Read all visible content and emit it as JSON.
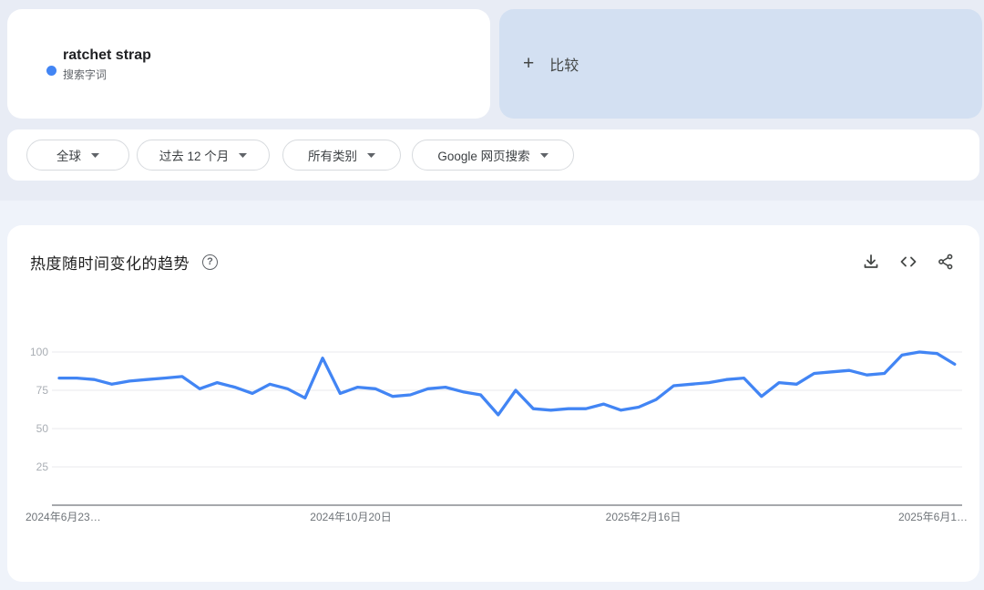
{
  "colors": {
    "accent": "#4285f4",
    "compare_card_bg": "#d3e0f2",
    "header_bg": "#e8ecf5",
    "results_bg": "#eff3fa",
    "grid_line": "#e8eaed",
    "axis_line": "#70757a",
    "y_tick_text": "#a9aeb4",
    "x_tick_text": "#70757a"
  },
  "term_card": {
    "term": "ratchet strap",
    "type_label": "搜索字词"
  },
  "compare_card": {
    "plus_symbol": "+",
    "label": "比较"
  },
  "filter_bar": {
    "filters": [
      {
        "label": "全球"
      },
      {
        "label": "过去 12 个月"
      },
      {
        "label": "所有类别"
      },
      {
        "label": "Google 网页搜索"
      }
    ]
  },
  "chart_section": {
    "title": "热度随时间变化的趋势",
    "help_glyph": "?",
    "actions": [
      {
        "icon": "download-icon"
      },
      {
        "icon": "embed-icon"
      },
      {
        "icon": "share-icon"
      }
    ]
  },
  "chart_data": {
    "type": "line",
    "title": "热度随时间变化的趋势",
    "x_tick_labels": [
      "2024年6月23…",
      "2024年10月20日",
      "2025年2月16日",
      "2025年6月1…"
    ],
    "y_ticks": [
      25,
      50,
      75,
      100
    ],
    "ylim": [
      0,
      100
    ],
    "grid": "horizontal",
    "legend": "none",
    "series": [
      {
        "name": "ratchet strap",
        "color": "#4285f4",
        "values": [
          83,
          83,
          82,
          79,
          81,
          82,
          83,
          84,
          76,
          80,
          77,
          73,
          79,
          76,
          70,
          96,
          73,
          77,
          76,
          71,
          72,
          76,
          77,
          74,
          72,
          59,
          75,
          63,
          62,
          63,
          63,
          66,
          62,
          64,
          69,
          78,
          79,
          80,
          82,
          83,
          71,
          80,
          79,
          86,
          87,
          88,
          85,
          86,
          98,
          100,
          99,
          92
        ]
      }
    ]
  }
}
